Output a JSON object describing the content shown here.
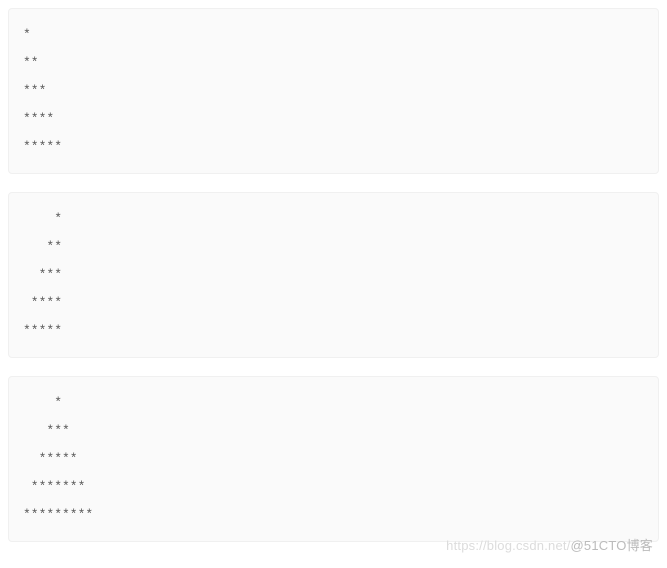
{
  "blocks": [
    {
      "content": "*\n**\n***\n****\n*****"
    },
    {
      "content": "    *\n   **\n  ***\n ****\n*****"
    },
    {
      "content": "    *\n   ***\n  *****\n *******\n*********"
    }
  ],
  "watermark": {
    "faint": "https://blog.csdn.net/",
    "main": "@51CTO博客"
  }
}
